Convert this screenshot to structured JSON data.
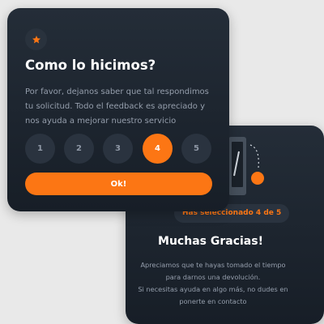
{
  "rating_card": {
    "icon": "star-icon",
    "title": "Como lo hicimos?",
    "description": "Por favor, dejanos saber que tal respondimos tu solicitud. Todo el feedback es apreciado y nos ayuda a mejorar nuestro servicio",
    "ratings": [
      "1",
      "2",
      "3",
      "4",
      "5"
    ],
    "selected_rating": "4",
    "submit_label": "Ok!"
  },
  "thanks_card": {
    "illustration": "phone-card-illustration",
    "badge": "Has seleccionado 4 de 5",
    "title": "Muchas Gracias!",
    "body": "Apreciamos que te hayas tomado el tiempo para darnos una devolución.\nSi necesitas ayuda en algo más, no dudes en ponerte en contacto"
  },
  "colors": {
    "accent": "#fc7614",
    "card_bg": "#1f2630",
    "muted_text": "#959eac",
    "page_bg": "#e9e9e9"
  }
}
